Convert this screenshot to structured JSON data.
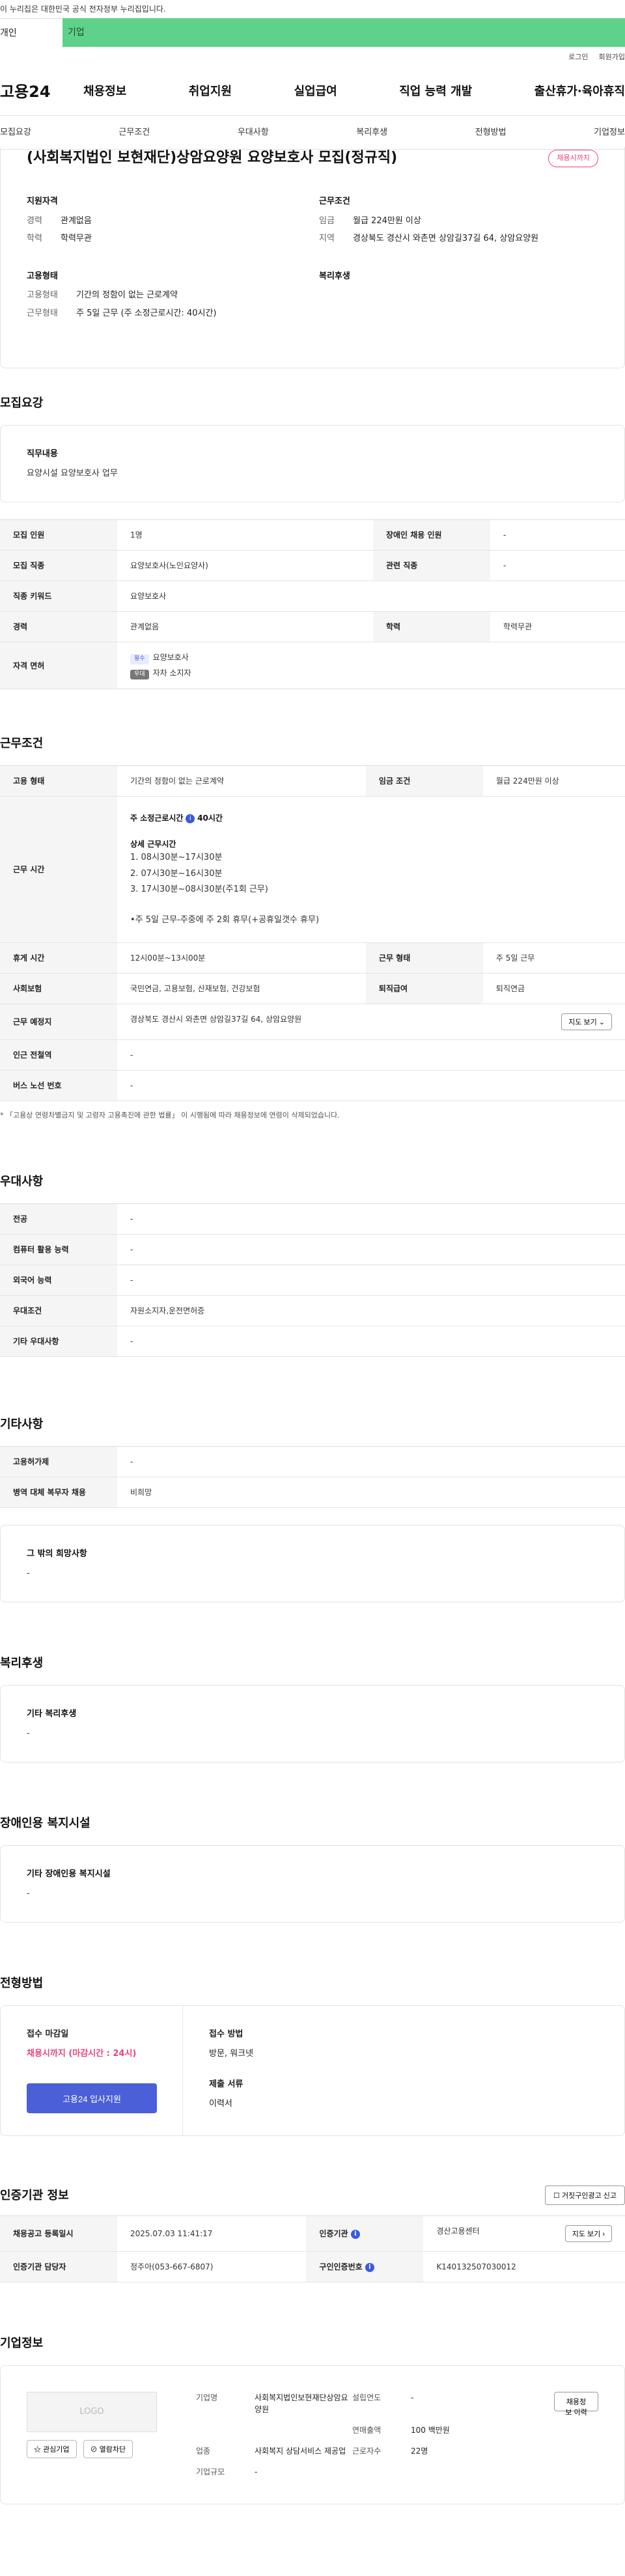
{
  "top_notice": "이 누리집은 대한민국 공식 전자정부 누리집입니다.",
  "tabs": {
    "personal": "개인",
    "corporate": "기업"
  },
  "util": {
    "login": "로그인",
    "signup": "회원가입"
  },
  "brand": "고용24",
  "gnb": [
    "채용정보",
    "취업지원",
    "실업급여",
    "직업 능력 개발",
    "출산휴가·육아휴직"
  ],
  "anchors": [
    "모집요강",
    "근무조건",
    "우대사항",
    "복리후생",
    "전형방법",
    "기업정보"
  ],
  "hero": {
    "title": "(사회복지법인 보현재단)상암요양원 요양보호사 모집(정규직)",
    "badge": "채용시까지",
    "qual_title": "지원자격",
    "qual": [
      {
        "k": "경력",
        "v": "관계없음"
      },
      {
        "k": "학력",
        "v": "학력무관"
      }
    ],
    "cond_title": "근무조건",
    "cond": [
      {
        "k": "임금",
        "v": "월급 224만원 이상"
      },
      {
        "k": "지역",
        "v": "경상북도 경산시 와촌면 상암길37길 64, 상암요양원"
      }
    ],
    "emp_title": "고용형태",
    "emp": [
      {
        "k": "고용형태",
        "v": "기간의 정함이 없는 근로계약"
      },
      {
        "k": "근무형태",
        "v": "주 5일 근무 (주 소정근로시간: 40시간)"
      }
    ],
    "welfare_title": "복리후생"
  },
  "recruit": {
    "title": "모집요강",
    "job_content_title": "직무내용",
    "job_content": "요양시설 요양보호사 업무",
    "rows": [
      {
        "k1": "모집 인원",
        "v1": "1명",
        "k2": "장애인 채용 인원",
        "v2": "-"
      },
      {
        "k1": "모집 직종",
        "v1": "요양보호사(노인요양사)",
        "k2": "관련 직종",
        "v2": "-"
      },
      {
        "k1": "직종 키워드",
        "v1": "요양보호사"
      },
      {
        "k1": "경력",
        "v1": "관계없음",
        "k2": "학력",
        "v2": "학력무관"
      }
    ],
    "license_k": "자격 면허",
    "license_req_tag": "필수",
    "license_req": "요양보호사",
    "license_pref_tag": "우대",
    "license_pref": "자차 소지자"
  },
  "work": {
    "title": "근무조건",
    "emp_k": "고용 형태",
    "emp_v": "기간의 정함이 없는 근로계약",
    "wage_k": "임금 조건",
    "wage_v": "월급 224만원 이상",
    "hours_k": "근무 시간",
    "hours_main": "주 소정근로시간",
    "hours_main_val": "40시간",
    "hours_detail_title": "상세 근무시간",
    "hours_lines": [
      "1. 08시30분~17시30분",
      "2. 07시30분~16시30분",
      "3. 17시30분~08시30분(주1회 근무)"
    ],
    "hours_note": "•주 5일 근무-주중에 주 2회 휴무(+공휴일갯수 휴무)",
    "break_k": "휴게 시간",
    "break_v": "12시00분~13시00분",
    "shift_k": "근무 형태",
    "shift_v": "주 5일 근무",
    "ins_k": "사회보험",
    "ins_v": "국민연금, 고용보험, 산재보험, 건강보험",
    "ret_k": "퇴직급여",
    "ret_v": "퇴직연금",
    "place_k": "근무 예정지",
    "place_v": "경상북도 경산시 와촌면 상암길37길 64, 상암요양원",
    "map_btn": "지도 보기",
    "station_k": "인근 전철역",
    "station_v": "-",
    "bus_k": "버스 노선 번호",
    "bus_v": "-",
    "note": "* 「고용상 연령차별금지 및 고령자 고용촉진에 관한 법률」 이 시행됨에 따라 채용정보에 연령이 삭제되었습니다."
  },
  "pref": {
    "title": "우대사항",
    "rows": [
      {
        "k": "전공",
        "v": "-"
      },
      {
        "k": "컴퓨터 활용 능력",
        "v": "-"
      },
      {
        "k": "외국어 능력",
        "v": "-"
      },
      {
        "k": "우대조건",
        "v": "자원소지자,운전면허증"
      },
      {
        "k": "기타 우대사항",
        "v": "-"
      }
    ]
  },
  "etc": {
    "title": "기타사항",
    "rows": [
      {
        "k": "고용허가제",
        "v": "-"
      },
      {
        "k": "병역 대체 복무자 채용",
        "v": "비희망"
      }
    ],
    "other_title": "그 밖의 희망사항",
    "other_v": "-"
  },
  "welfare": {
    "title": "복리후생",
    "box_title": "기타 복리후생",
    "box_v": "-"
  },
  "disability": {
    "title": "장애인용 복지시설",
    "box_title": "기타 장애인용 복지시설",
    "box_v": "-"
  },
  "apply": {
    "title": "전형방법",
    "deadline_title": "접수 마감일",
    "deadline": "채용시까지 (마감시간 : 24시)",
    "apply_btn": "고용24 입사지원",
    "method_title": "접수 방법",
    "method": "방문, 워크넷",
    "docs_title": "제출 서류",
    "docs": "이력서"
  },
  "agency": {
    "title": "인증기관 정보",
    "report_btn": "거짓구인광고 신고",
    "reg_k": "채용공고 등록일시",
    "reg_v": "2025.07.03 11:41:17",
    "agency_k": "인증기관",
    "agency_v": "경산고용센터",
    "map_btn": "지도 보기",
    "manager_k": "인증기관 담당자",
    "manager_v": "정주아(053-667-6807)",
    "num_k": "구인인증번호",
    "num_v": "K140132507030012"
  },
  "company": {
    "title": "기업정보",
    "logo": "LOGO",
    "fav_btn": "관심기업",
    "block_btn": "열람차단",
    "name_k": "기업명",
    "name_v": "사회복지법인보현재단상암요양원",
    "year_k": "설립연도",
    "year_v": "-",
    "sales_k": "연매출액",
    "sales_v": "100 백만원",
    "industry_k": "업종",
    "industry_v": "사회복지 상담서비스 제공업",
    "emp_k": "근로자수",
    "emp_v": "22명",
    "size_k": "기업규모",
    "size_v": "-",
    "hist_btn": "채용정보 이력"
  }
}
